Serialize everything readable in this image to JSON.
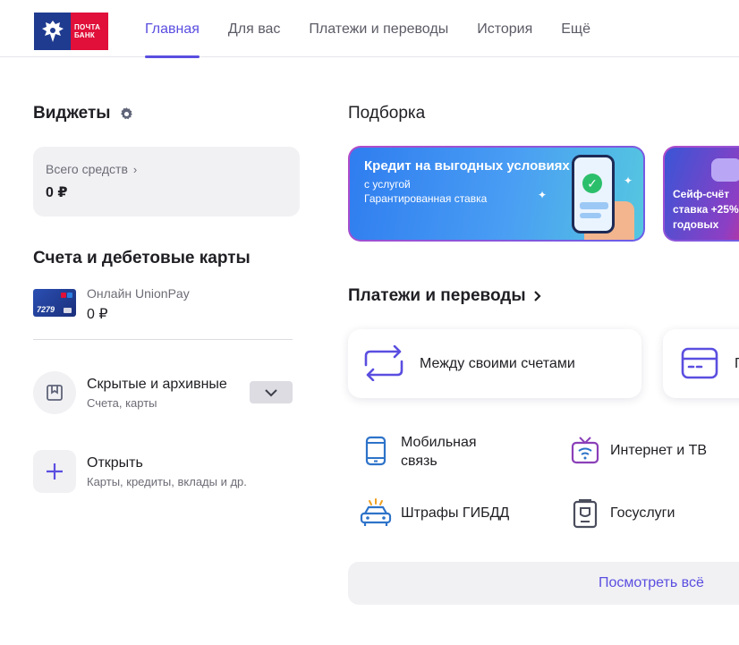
{
  "brand": {
    "logo_text_line1": "ПОЧТА",
    "logo_text_line2": "БАНК",
    "emblem_color": "#1e3b8f",
    "brand_color": "#e0103a"
  },
  "nav": {
    "items": [
      {
        "label": "Главная",
        "active": true
      },
      {
        "label": "Для вас",
        "active": false
      },
      {
        "label": "Платежи и переводы",
        "active": false
      },
      {
        "label": "История",
        "active": false
      },
      {
        "label": "Ещё",
        "active": false
      }
    ],
    "accent_color": "#5a4ee0"
  },
  "widgets": {
    "title": "Виджеты",
    "settings_icon": "gear-icon",
    "total_label": "Всего средств",
    "total_value": "0 ₽"
  },
  "accounts": {
    "title": "Счета и дебетовые карты",
    "card": {
      "number_short": "7279",
      "name": "Онлайн UnionPay",
      "balance": "0 ₽"
    },
    "hidden": {
      "title": "Скрытые и архивные",
      "subtitle": "Счета, карты"
    },
    "open": {
      "title": "Открыть",
      "subtitle": "Карты, кредиты, вклады и др."
    }
  },
  "promo": {
    "title": "Подборка",
    "banner1": {
      "title": "Кредит на выгодных условиях",
      "sub_line1": "с услугой",
      "sub_line2": "Гарантированная ставка"
    },
    "banner2": {
      "line1": "Сейф-счёт",
      "line2": "ставка +25%",
      "line3": "годовых"
    }
  },
  "payments": {
    "title": "Платежи и переводы",
    "transfer_own": "Между своими счетами",
    "transfer_card_partial": "П",
    "services": [
      {
        "label": "Мобильная\nсвязь",
        "icon": "mobile-icon"
      },
      {
        "label": "Интернет и ТВ",
        "icon": "tv-icon"
      },
      {
        "label": "Штрафы ГИБДД",
        "icon": "police-car-icon"
      },
      {
        "label": "Госуслуги",
        "icon": "gov-services-icon"
      }
    ],
    "see_all": "Посмотреть всё"
  }
}
